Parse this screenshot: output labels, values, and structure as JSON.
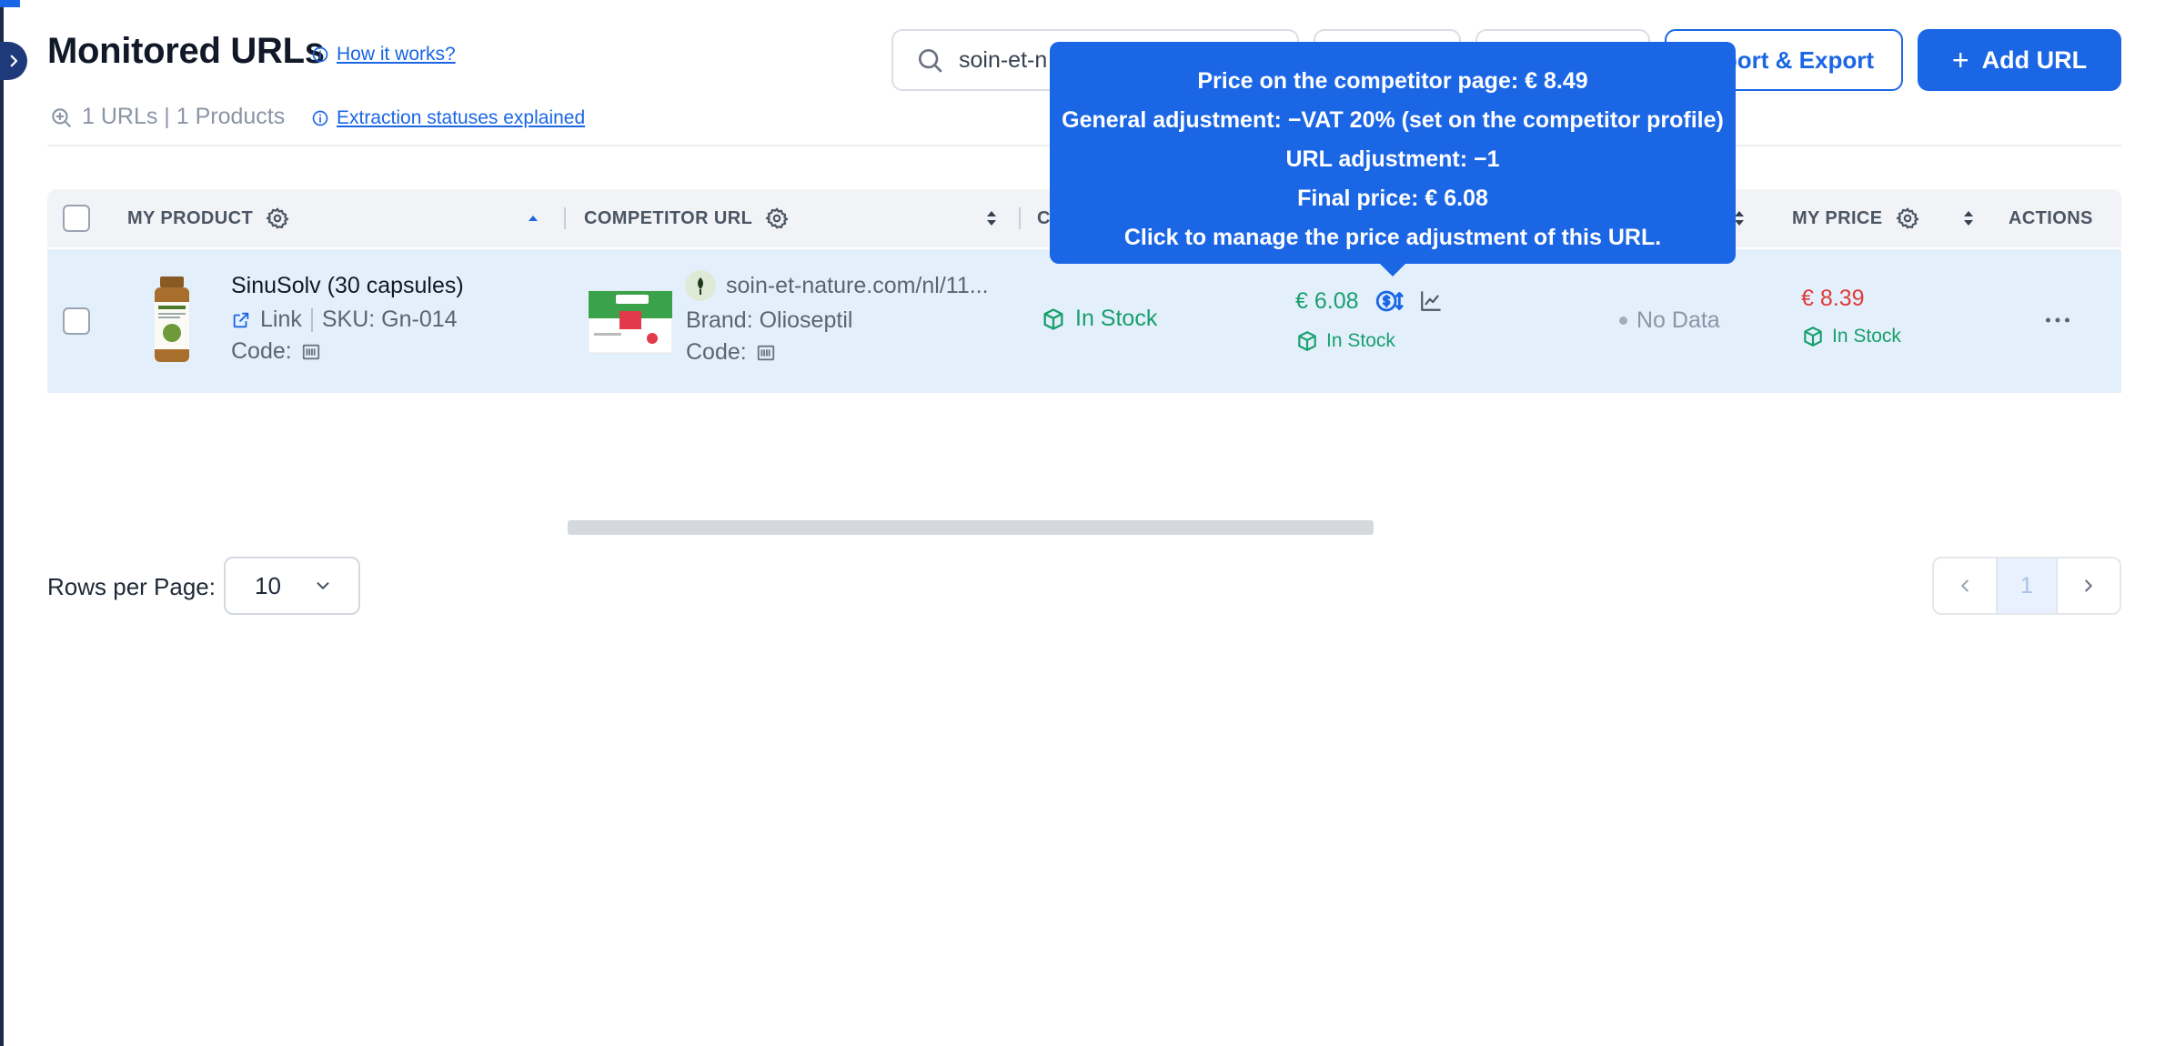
{
  "app": {
    "page_title": "Monitored URLs",
    "how_it_works": "How it works?",
    "counts": "1 URLs | 1 Products",
    "extraction_link": "Extraction statuses explained"
  },
  "toolbar": {
    "search_value": "soin-et-n",
    "import_export_label": "Import & Export",
    "add_url_label": "Add URL",
    "accent_color": "#1a66e5"
  },
  "table": {
    "headers": {
      "my_product": "MY PRODUCT",
      "competitor_url": "COMPETITOR URL",
      "competitor_stock_partial": "C",
      "my_price": "MY PRICE",
      "actions": "ACTIONS"
    },
    "rows": [
      {
        "product_name": "SinuSolv (30 capsules)",
        "link_label": "Link",
        "sku": "SKU: Gn-014",
        "code_label": "Code:",
        "competitor_url": "soin-et-nature.com/nl/11...",
        "brand": "Brand: Olioseptil",
        "competitor_code_label": "Code:",
        "competitor_stock": "In Stock",
        "competitor_price": "€ 6.08",
        "competitor_price_stock": "In Stock",
        "other_status": "No Data",
        "my_price": "€ 8.39",
        "my_stock": "In Stock"
      }
    ]
  },
  "tooltip": {
    "line1": "Price on the competitor page: € 8.49",
    "line2": "General adjustment: −VAT 20% (set on the competitor profile)",
    "line3": "URL adjustment: −1",
    "line4": "Final price: € 6.08",
    "line5": "Click to manage the price adjustment of this URL."
  },
  "pagination": {
    "rows_per_page_label": "Rows per Page:",
    "rows_per_page_value": "10",
    "current_page": "1"
  },
  "status_colors": {
    "in_stock": "#16a06b",
    "my_price": "#e03a3a",
    "row_highlight": "#e4effc"
  }
}
